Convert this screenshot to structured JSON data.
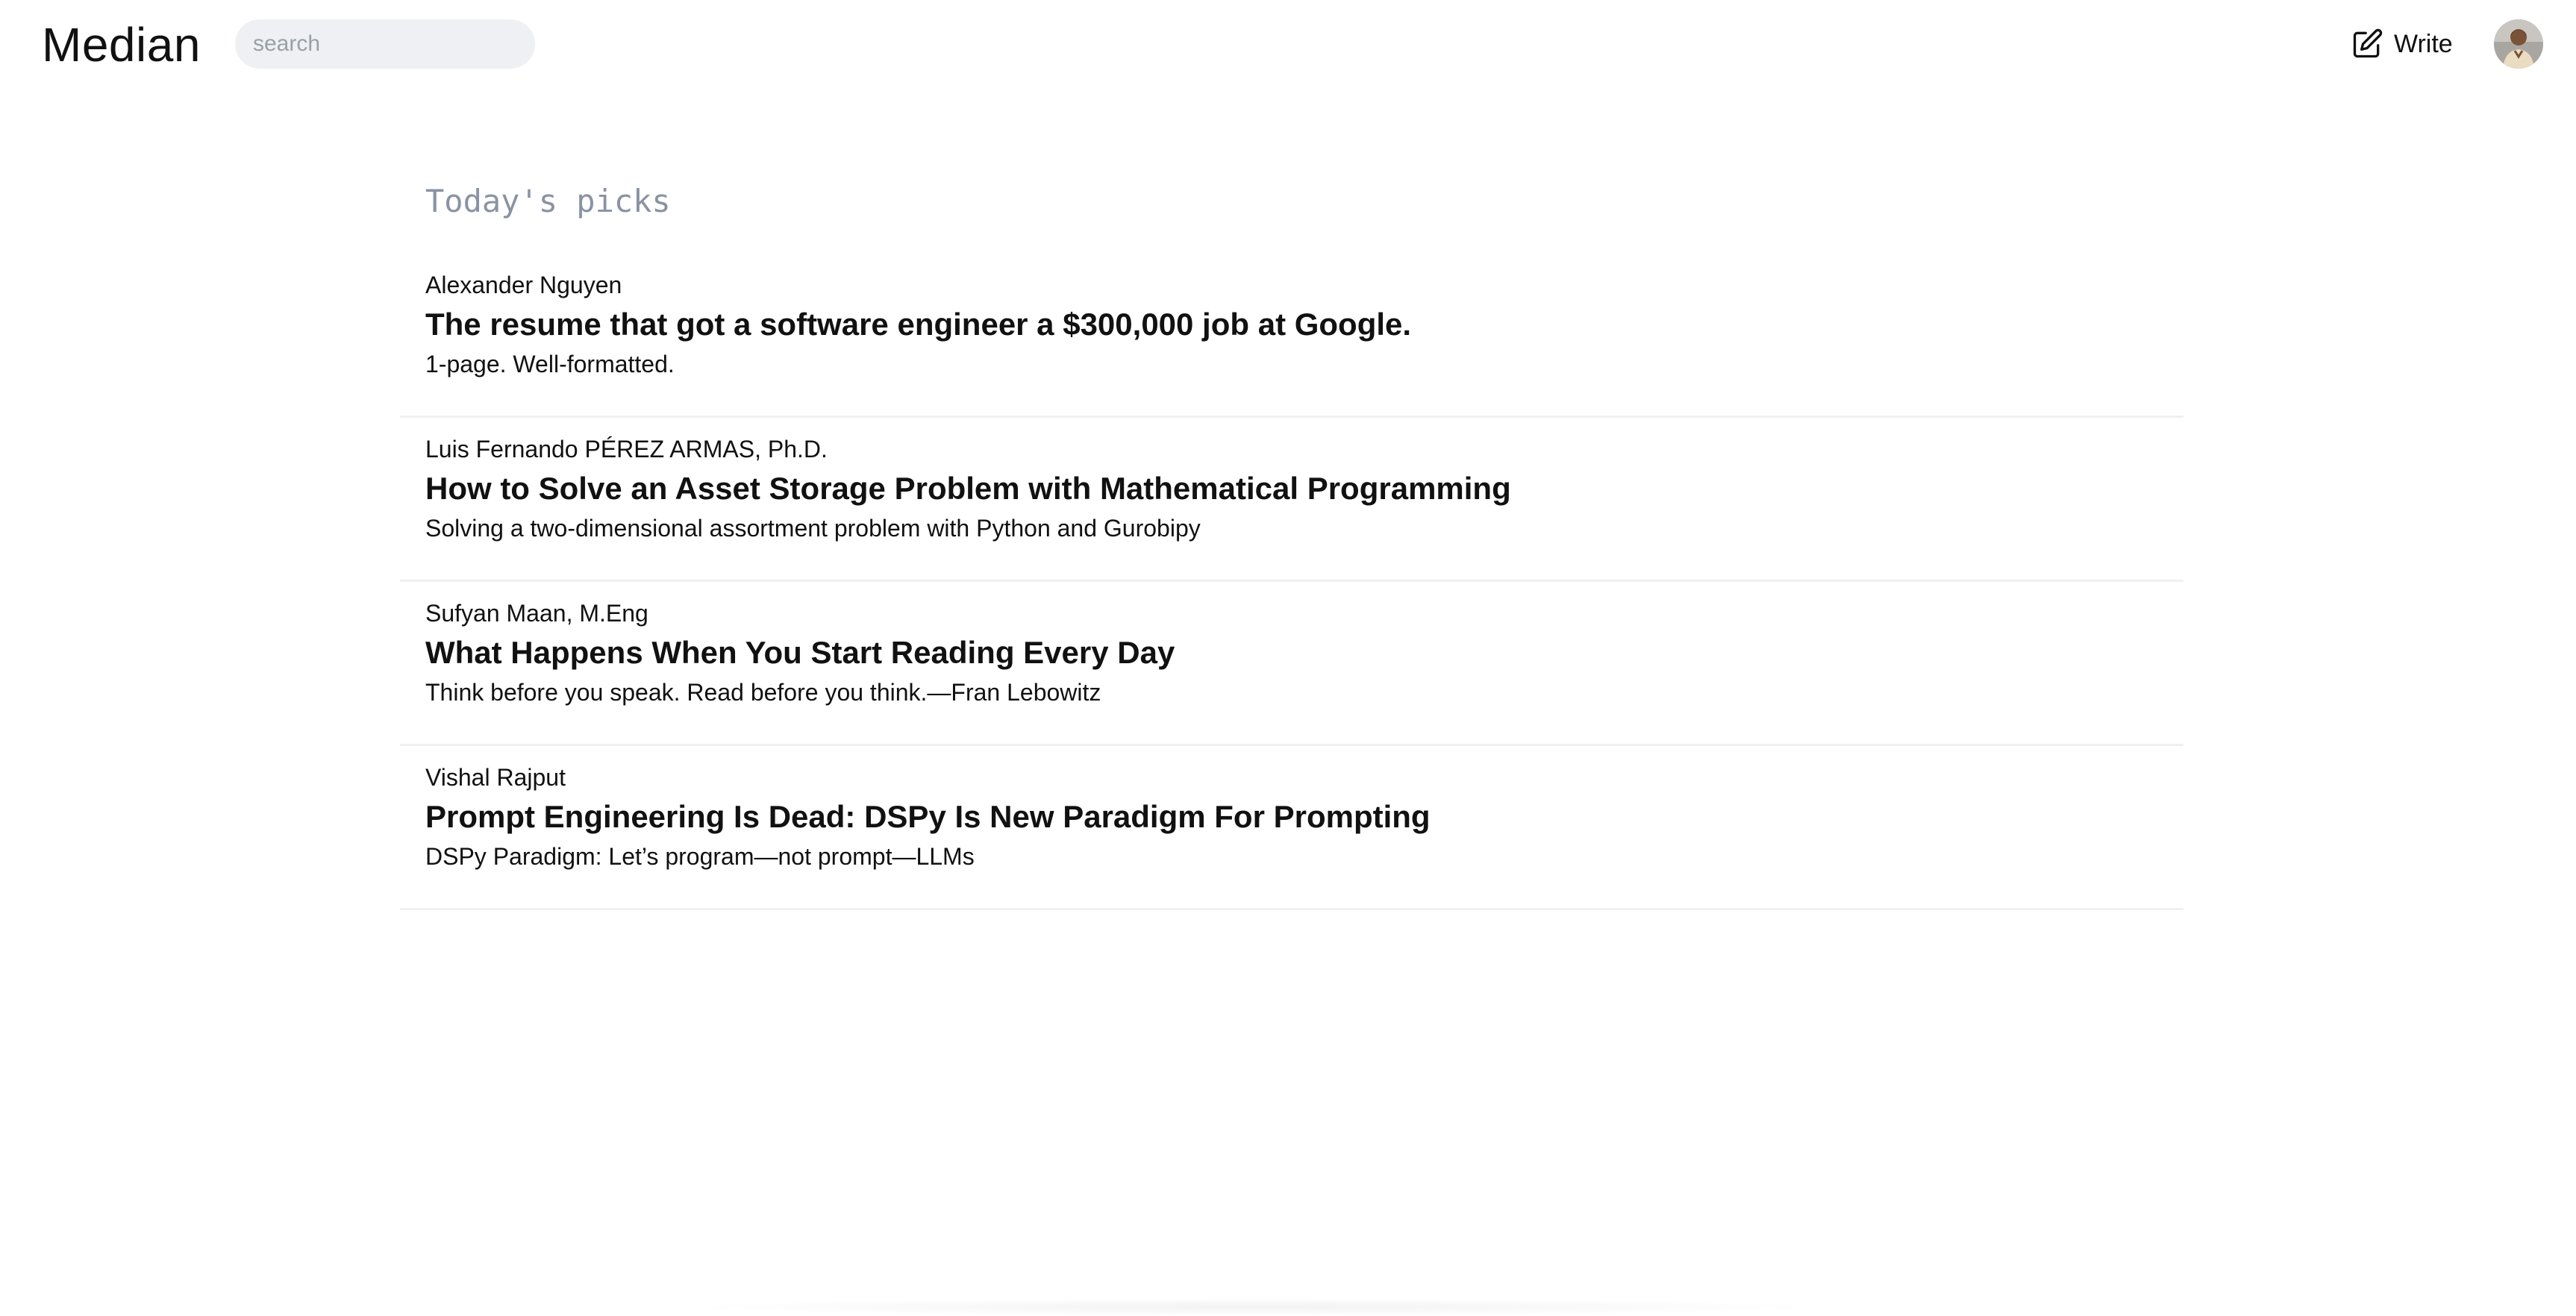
{
  "header": {
    "brand": "Median",
    "search": {
      "placeholder": "search",
      "value": ""
    },
    "write_label": "Write",
    "write_icon": "pencil-square-icon",
    "avatar_icon": "user-avatar"
  },
  "main": {
    "section_title": "Today's picks",
    "posts": [
      {
        "author": "Alexander Nguyen",
        "title": "The resume that got a software engineer a $300,000 job at Google.",
        "subtitle": "1-page. Well-formatted."
      },
      {
        "author": "Luis Fernando PÉREZ ARMAS, Ph.D.",
        "title": "How to Solve an Asset Storage Problem with Mathematical Programming",
        "subtitle": "Solving a two-dimensional assortment problem with Python and Gurobipy"
      },
      {
        "author": "Sufyan Maan, M.Eng",
        "title": "What Happens When You Start Reading Every Day",
        "subtitle": "Think before you speak. Read before you think.—Fran Lebowitz"
      },
      {
        "author": "Vishal Rajput",
        "title": "Prompt Engineering Is Dead: DSPy Is New Paradigm For Prompting",
        "subtitle": "DSPy Paradigm: Let’s program—not prompt—LLMs"
      }
    ]
  },
  "colors": {
    "background": "#ffffff",
    "text": "#111111",
    "muted": "#8a93a3",
    "search_bg": "#eef0f3",
    "divider": "#eef0f2"
  }
}
